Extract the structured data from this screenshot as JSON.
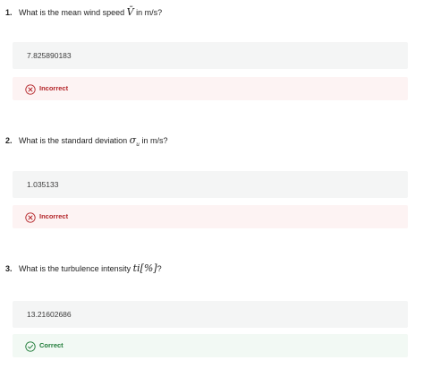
{
  "questions": [
    {
      "number": "1.",
      "prompt_before": "What is the mean wind speed",
      "math": "V̄",
      "math_sub": "",
      "prompt_after": "in m/s?",
      "answer": "7.825890183",
      "feedback": "Incorrect",
      "status": "incorrect"
    },
    {
      "number": "2.",
      "prompt_before": "What is the standard deviation",
      "math": "σ",
      "math_sub": "u",
      "prompt_after": "in m/s?",
      "answer": "1.035133",
      "feedback": "Incorrect",
      "status": "incorrect"
    },
    {
      "number": "3.",
      "prompt_before": "What is the turbulence intensity",
      "math": "ti[%]",
      "math_sub": "",
      "prompt_after": "?",
      "answer": "13.21602686",
      "feedback": "Correct",
      "status": "correct"
    }
  ],
  "colors": {
    "incorrect": "#b4262a",
    "incorrect_bg": "#fdf3f3",
    "correct": "#1e7b37",
    "correct_bg": "#f2f9f4",
    "answer_bg": "#f4f5f5"
  },
  "icons": {
    "incorrect": "x-circle-icon",
    "correct": "check-circle-icon"
  }
}
